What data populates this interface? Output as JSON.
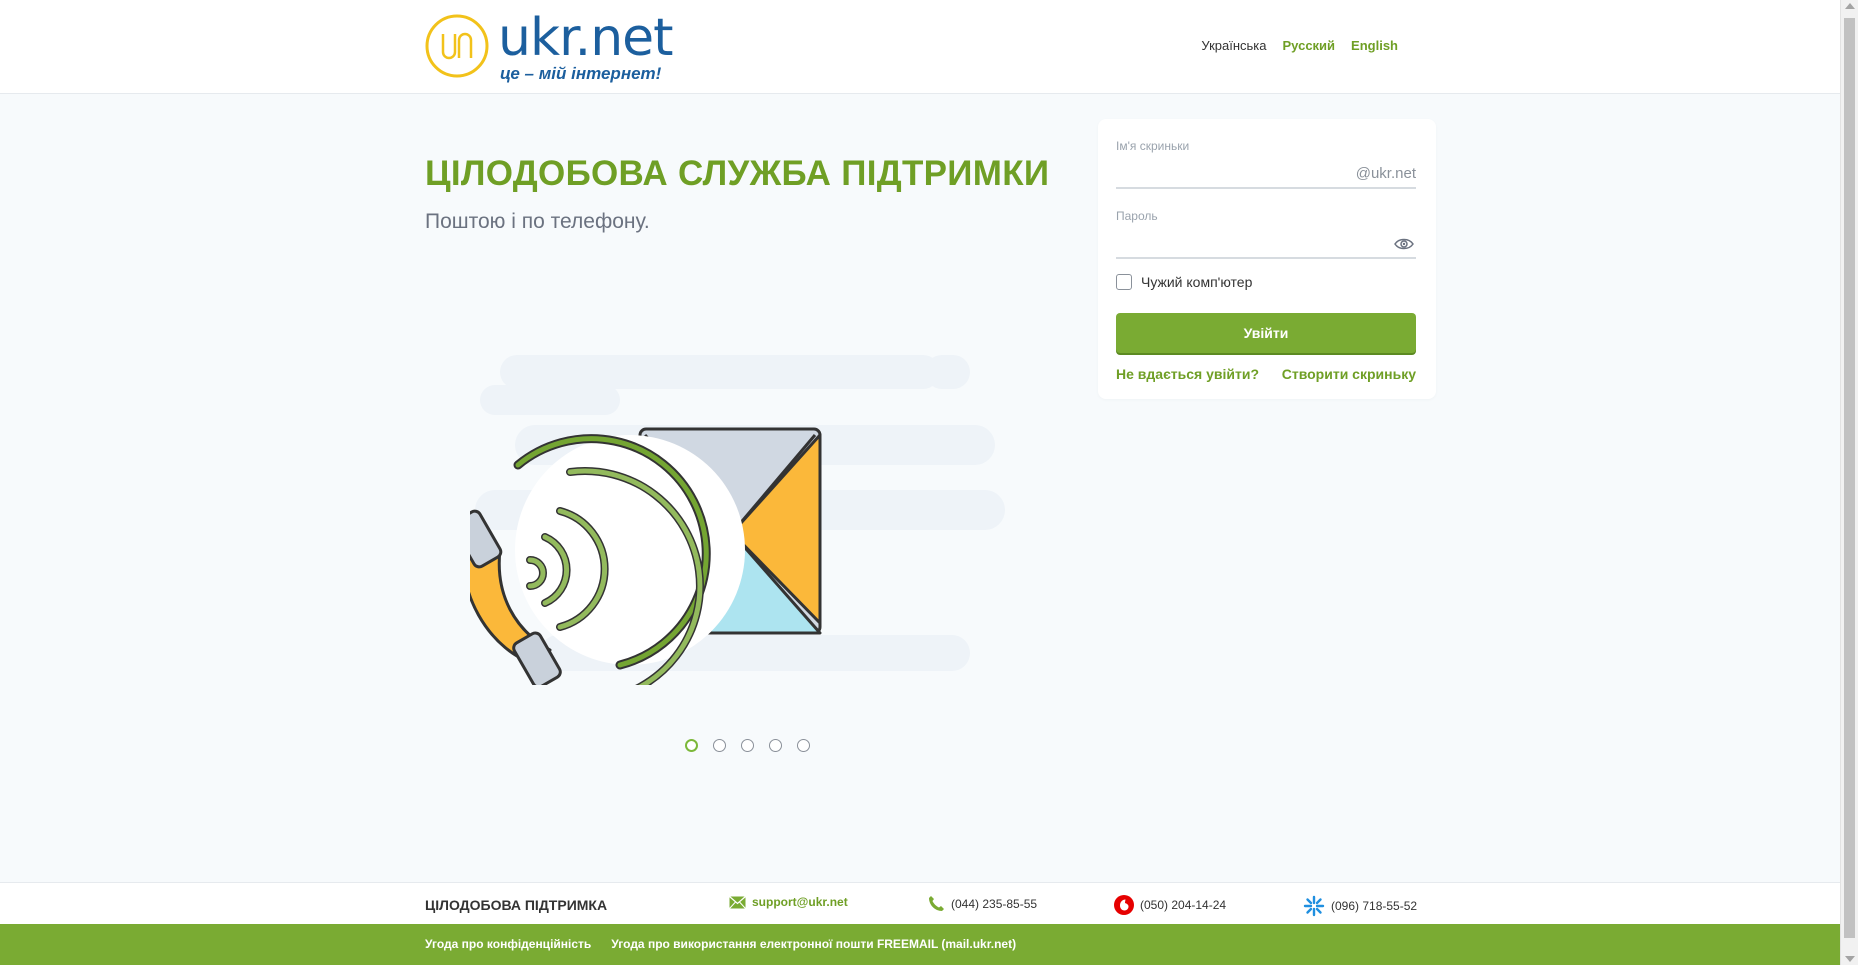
{
  "header": {
    "logo_text": "ukr.net",
    "logo_slogan": "це – мій інтернет!",
    "languages": [
      {
        "label": "Українська",
        "active": true
      },
      {
        "label": "Русский",
        "active": false
      },
      {
        "label": "English",
        "active": false
      }
    ]
  },
  "promo": {
    "title": "ЦІЛОДОБОВА СЛУЖБА ПІДТРИМКИ",
    "subtitle": "Поштою і по телефону.",
    "slides_total": 5,
    "active_slide": 1
  },
  "login": {
    "mailbox_label": "Ім'я скриньки",
    "mailbox_value": "",
    "mailbox_suffix": "@ukr.net",
    "password_label": "Пароль",
    "password_value": "",
    "foreign_computer_label": "Чужий комп'ютер",
    "foreign_computer_checked": false,
    "submit_label": "Увійти",
    "cant_login_link": "Не вдається увійти?",
    "create_mailbox_link": "Створити скриньку"
  },
  "support": {
    "title": "ЦІЛОДОБОВА ПІДТРИМКА",
    "email": "support@ukr.net",
    "phone_landline": "(044) 235-85-55",
    "phone_vodafone": "(050) 204-14-24",
    "phone_kyivstar": "(096) 718-55-52"
  },
  "footer": {
    "privacy_link": "Угода про конфіденційність",
    "terms_link": "Угода про використання електронної пошти FREEMAIL (mail.ukr.net)"
  },
  "colors": {
    "brand_green": "#7aab33",
    "title_green": "#6f9f25",
    "logo_blue": "#1c5f9e",
    "logo_yellow": "#f2c21a"
  },
  "icons": [
    "ukrnet-logo-icon",
    "eye-icon",
    "envelope-icon",
    "phone-icon",
    "vodafone-icon",
    "kyivstar-icon"
  ]
}
